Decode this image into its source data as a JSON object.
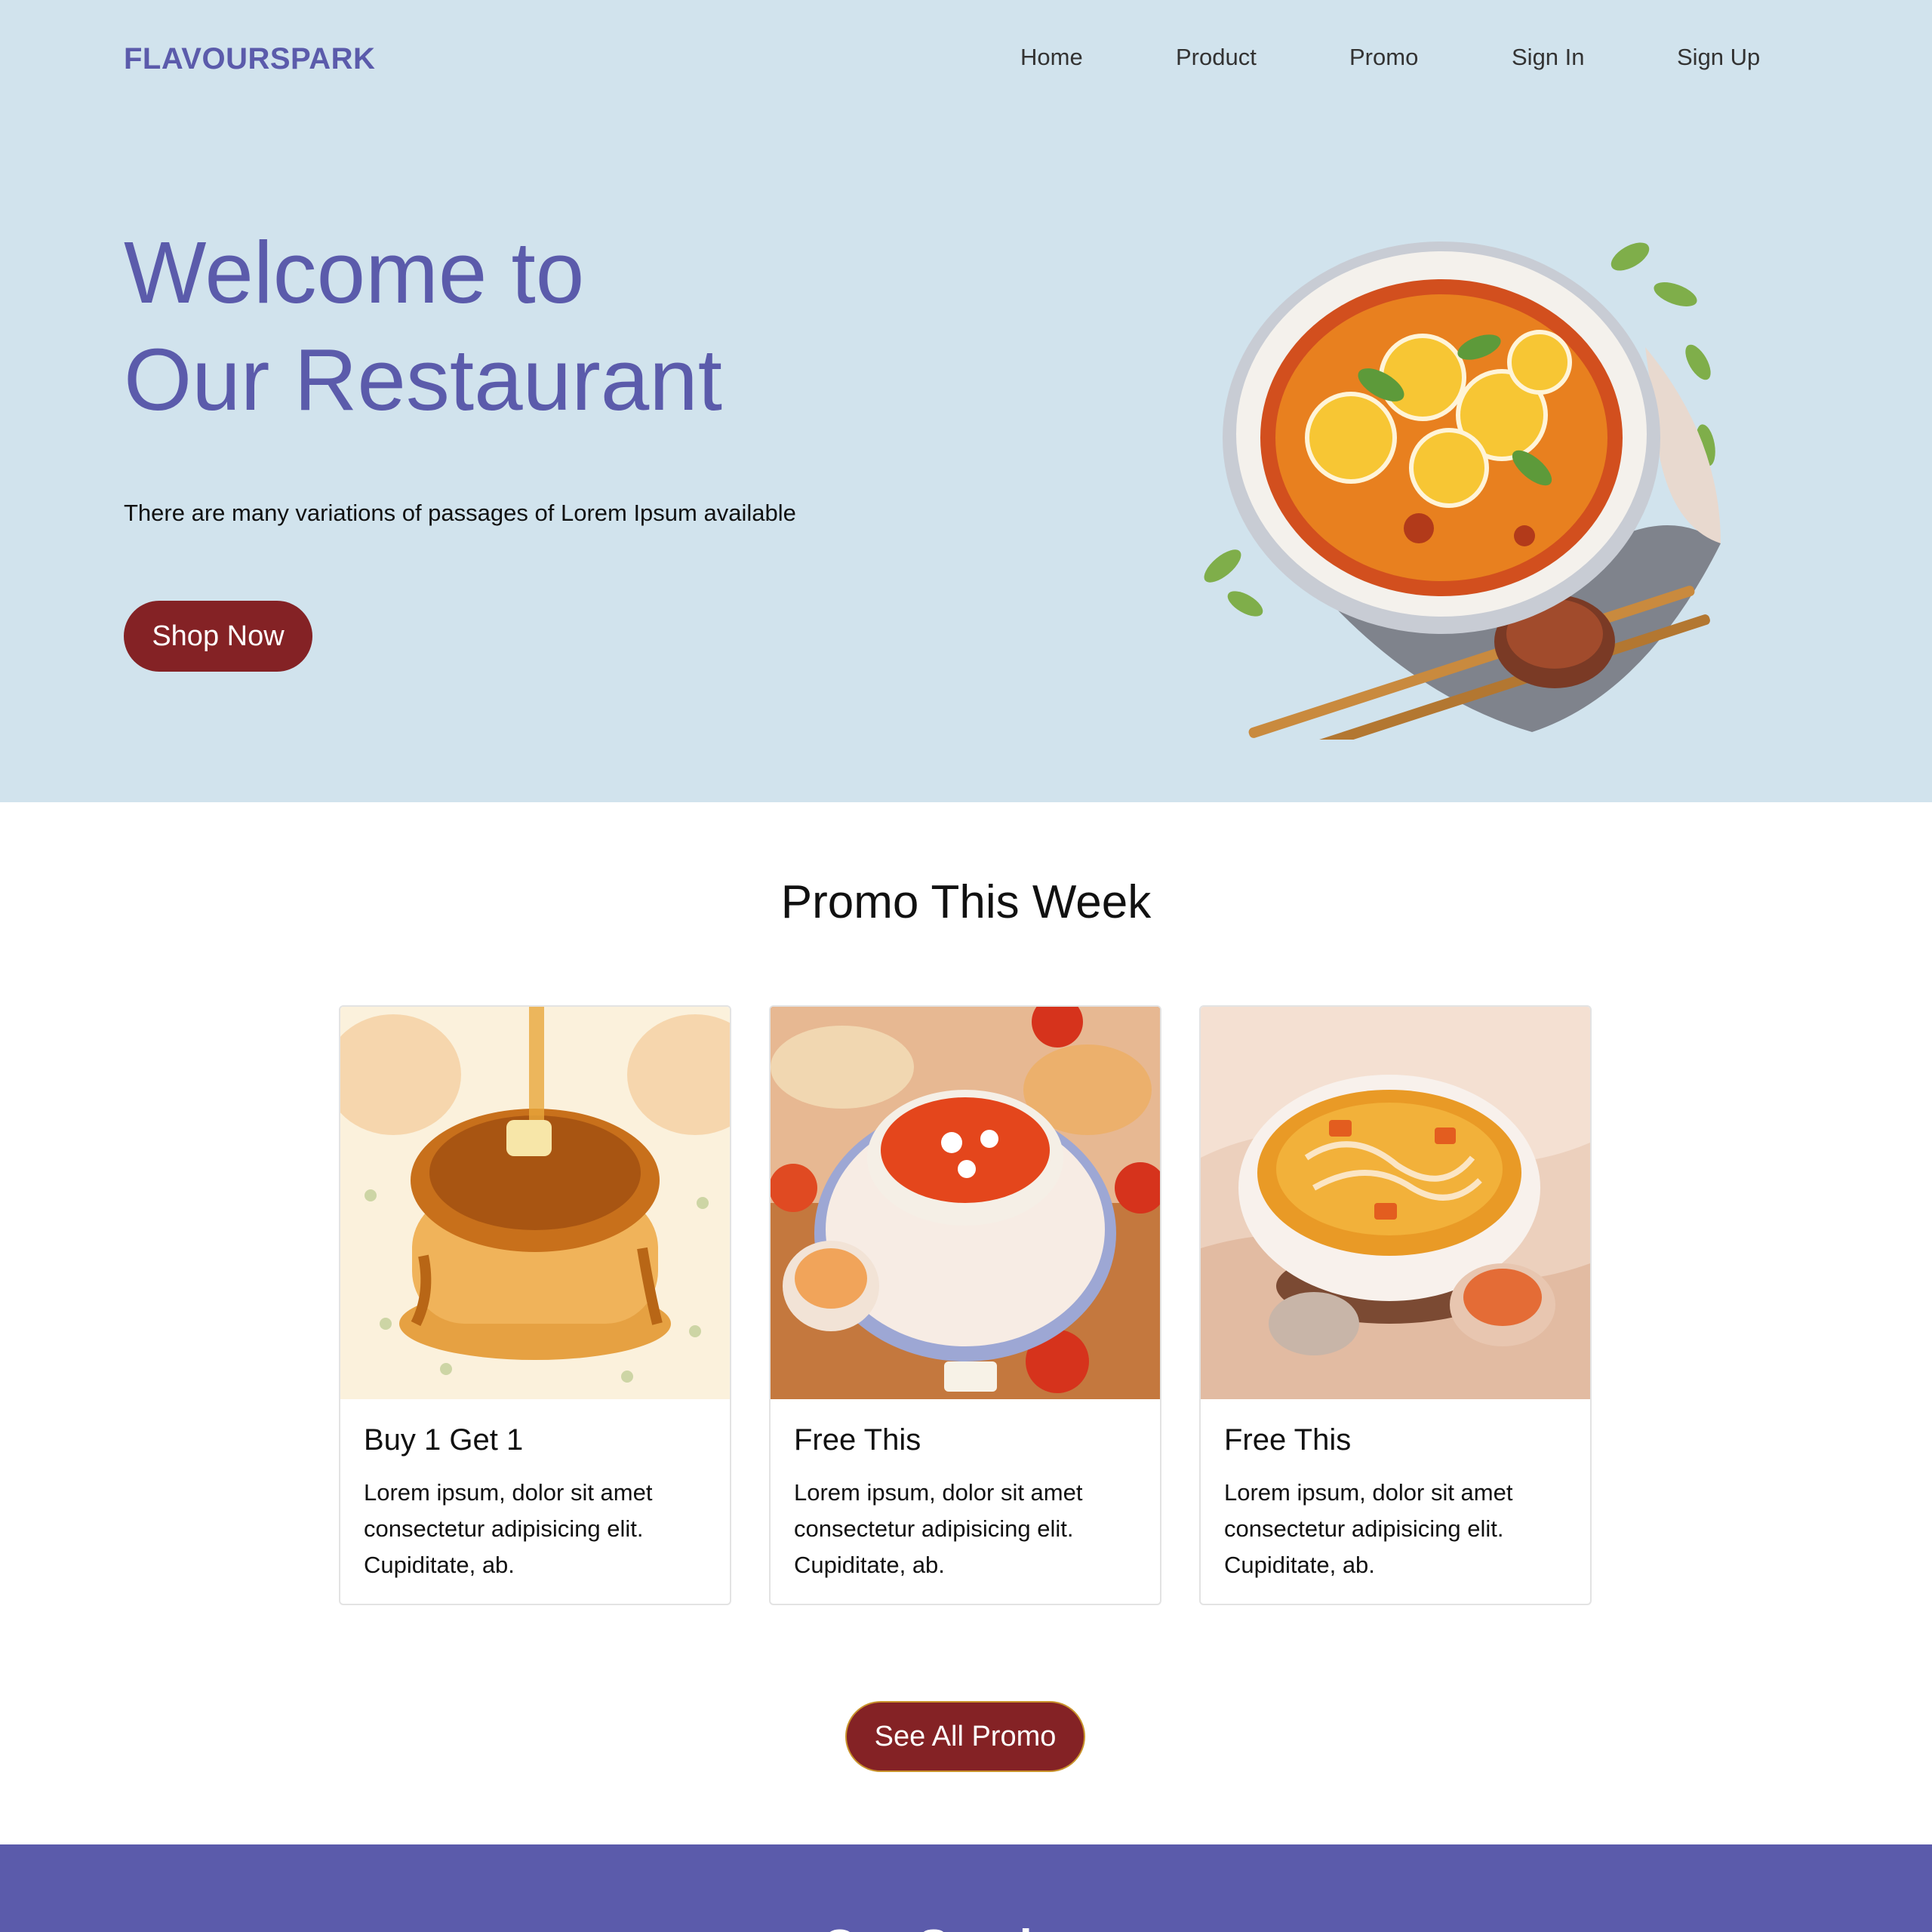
{
  "brand": "FLAVOURSPARK",
  "nav": {
    "home": "Home",
    "product": "Product",
    "promo": "Promo",
    "sign_in": "Sign In",
    "sign_up": "Sign Up"
  },
  "hero": {
    "title_line1": "Welcome to",
    "title_line2": "Our Restaurant",
    "subtitle": "There are many variations of passages of Lorem Ipsum available",
    "cta": "Shop Now"
  },
  "promo": {
    "heading": "Promo This Week",
    "cards": [
      {
        "title": "Buy 1 Get 1",
        "text": "Lorem ipsum, dolor sit amet consectetur adipisicing elit. Cupiditate, ab."
      },
      {
        "title": "Free This",
        "text": "Lorem ipsum, dolor sit amet consectetur adipisicing elit. Cupiditate, ab."
      },
      {
        "title": "Free This",
        "text": "Lorem ipsum, dolor sit amet consectetur adipisicing elit. Cupiditate, ab."
      }
    ],
    "see_all": "See All Promo"
  },
  "band": {
    "title": "Our Services"
  },
  "colors": {
    "hero_bg": "#d1e3ed",
    "brand": "#5b5bab",
    "button": "#842225",
    "band": "#5b5bab"
  }
}
